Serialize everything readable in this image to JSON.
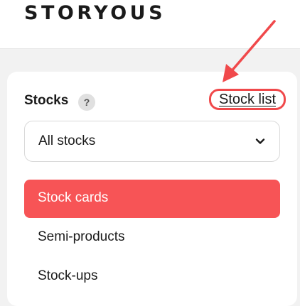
{
  "header": {
    "logo_text": "STORYOUS"
  },
  "stocks": {
    "title": "Stocks",
    "help_glyph": "?",
    "help_icon": "question-mark-icon",
    "stock_list_link": "Stock list",
    "select": {
      "value": "All stocks",
      "icon": "chevron-down-icon"
    },
    "menu": {
      "items": [
        {
          "label": "Stock cards",
          "active": true
        },
        {
          "label": "Semi-products",
          "active": false
        },
        {
          "label": "Stock-ups",
          "active": false
        }
      ]
    }
  },
  "annotation": {
    "arrow_icon": "red-arrow-pointer",
    "highlight_color": "#f0494b"
  },
  "colors": {
    "accent": "#f75456",
    "annotation": "#f0494b",
    "text": "#1a1a1a",
    "background": "#f2f2f2"
  }
}
